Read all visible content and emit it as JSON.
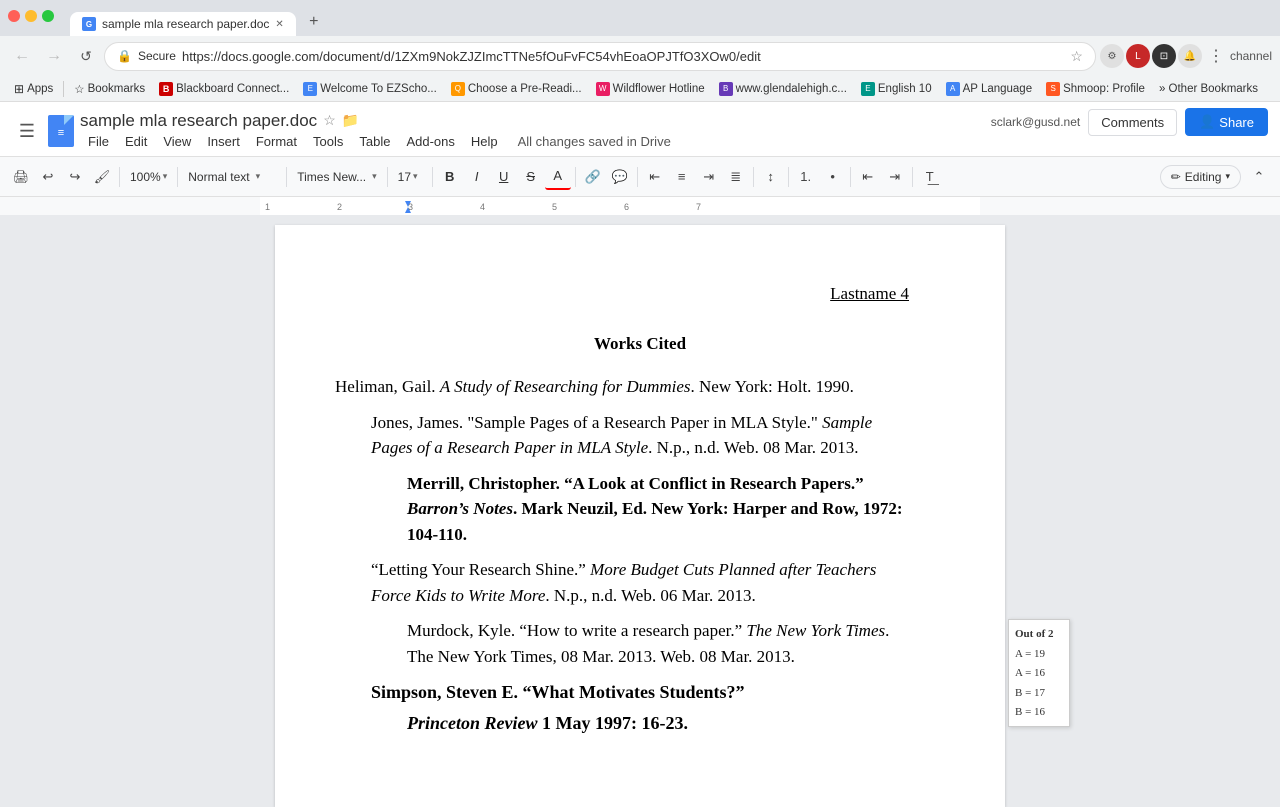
{
  "browser": {
    "tab": {
      "title": "sample mla research paper.doc",
      "favicon": "G"
    },
    "url": "https://docs.google.com/document/d/1ZXm9NokZJZImcTTNe5fOuFvFC54vhEoaOPJTfO3XOw0/edit",
    "secure_label": "Secure",
    "new_tab_icon": "+"
  },
  "bookmarks": [
    {
      "label": "Apps",
      "icon": "⊞"
    },
    {
      "label": "Bookmarks"
    },
    {
      "label": "Blackboard Connect..."
    },
    {
      "label": "Welcome To EZScho..."
    },
    {
      "label": "Choose a Pre-Readi..."
    },
    {
      "label": "Wildflower Hotline"
    },
    {
      "label": "www.glendalehigh.c..."
    },
    {
      "label": "English 10"
    },
    {
      "label": "AP Language"
    },
    {
      "label": "Shmoop: Profile"
    },
    {
      "label": "Other Bookmarks"
    }
  ],
  "docs": {
    "title": "sample mla research paper.doc",
    "saved_status": "All changes saved in Drive",
    "user_email": "sclark@gusd.net",
    "menu_items": [
      "File",
      "Edit",
      "View",
      "Insert",
      "Format",
      "Tools",
      "Table",
      "Add-ons",
      "Help"
    ],
    "toolbar": {
      "print_label": "🖨",
      "undo_label": "↩",
      "redo_label": "↪",
      "paintformat_label": "🖌",
      "zoom_value": "100%",
      "style_value": "Normal text",
      "font_value": "Times New...",
      "size_value": "17",
      "bold_label": "B",
      "italic_label": "I",
      "underline_label": "U",
      "strikethrough_label": "S",
      "text_color_label": "A",
      "link_label": "🔗",
      "comment_label": "💬",
      "align_left": "≡",
      "align_center": "≡",
      "align_right": "≡",
      "align_justify": "≡",
      "line_spacing": "≡",
      "num_list": "1.",
      "bullet_list": "•",
      "indent_dec": "⇤",
      "indent_inc": "⇥",
      "clear_format": "T",
      "editing_mode": "Editing",
      "chevron_up": "⌃"
    },
    "document": {
      "header_right": "Lastname 4",
      "title": "Works Cited",
      "citations": [
        {
          "id": 1,
          "text": "Heliman, Gail. <em>A Study of Researching for Dummies</em>. New York: Holt. 1990."
        },
        {
          "id": 2,
          "text": "Jones, James. \"Sample Pages of a Research Paper in MLA Style.\" <em>Sample Pages of a Research Paper in MLA Style</em>. N.p., n.d. Web. 08 Mar. 2013."
        },
        {
          "id": 3,
          "indent": true,
          "text": "Merrill, Christopher. “A Look at Conflict in Research Papers.”  <strong><em>Barron’s Notes</em>. Mark Neuzil, Ed. New York: Harper and Row, 1972: 104-110.</strong>"
        },
        {
          "id": 4,
          "text": "\"Letting Your Research Shine.\" <em>More Budget Cuts Planned after Teachers Force Kids to Write More</em>. N.p., n.d. Web. 06 Mar. 2013."
        },
        {
          "id": 5,
          "indent": true,
          "text": "Murdock, Kyle. \"How to write a research paper.\" <em>The New York Times</em>. The New York Times, 08 Mar. 2013. Web. 08 Mar. 2013."
        },
        {
          "id": 6,
          "text": "Simpson, Steven E. “What Motivates Students?”"
        },
        {
          "id": 7,
          "indent": true,
          "text": "<em>Princeton Review</em> 1 May 1997: 16-23."
        }
      ]
    },
    "score_panel": {
      "title": "Out of 2",
      "rows": [
        "A = 19",
        "A = 16",
        "B = 17",
        "B = 16"
      ]
    }
  }
}
